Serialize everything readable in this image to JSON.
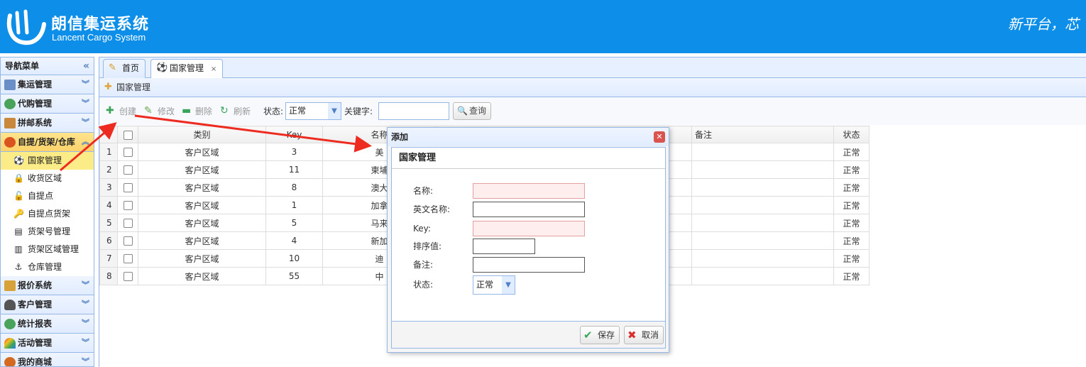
{
  "header": {
    "brand_cn": "朗信集运系统",
    "brand_en": "Lancent Cargo System",
    "slogan": "新平台，芯"
  },
  "sidebar": {
    "title": "导航菜单",
    "collapse_icon": "«",
    "groups": [
      {
        "label": "集运管理",
        "icon": "monitor-icon",
        "color": "#6a8fc7"
      },
      {
        "label": "代购管理",
        "icon": "globe-icon",
        "color": "#4aa35a"
      },
      {
        "label": "拼邮系统",
        "icon": "box-icon",
        "color": "#c9883c"
      },
      {
        "label": "自提/货架/仓库",
        "icon": "stop-icon",
        "color": "#d9541e"
      },
      {
        "label": "报价系统",
        "icon": "coins-icon",
        "color": "#d8a23a"
      },
      {
        "label": "客户管理",
        "icon": "user-icon",
        "color": "#555"
      },
      {
        "label": "统计报表",
        "icon": "globe-icon",
        "color": "#4aa35a"
      },
      {
        "label": "活动管理",
        "icon": "rainbow-icon",
        "color": "#e56b2f"
      },
      {
        "label": "我的商城",
        "icon": "ball-icon",
        "color": "#d46a1f"
      }
    ],
    "sub_items": [
      {
        "label": "国家管理",
        "icon": "⚽"
      },
      {
        "label": "收货区域",
        "icon": "🔒"
      },
      {
        "label": "自提点",
        "icon": "🔓"
      },
      {
        "label": "自提点货架",
        "icon": "🔑"
      },
      {
        "label": "货架号管理",
        "icon": "▤"
      },
      {
        "label": "货架区域管理",
        "icon": "▥"
      },
      {
        "label": "仓库管理",
        "icon": "⚓"
      }
    ]
  },
  "tabs": [
    {
      "label": "首页",
      "icon": "✎"
    },
    {
      "label": "国家管理",
      "icon": "⚽",
      "close": "×"
    }
  ],
  "panel": {
    "title": "国家管理"
  },
  "toolbar": {
    "create": "创建",
    "edit": "修改",
    "delete": "删除",
    "refresh": "刷新",
    "status_label": "状态:",
    "status_value": "正常",
    "keyword_label": "关键字:",
    "keyword_value": "",
    "search": "查询"
  },
  "grid": {
    "columns": [
      "类别",
      "Key",
      "名称",
      "备注",
      "状态"
    ],
    "rows": [
      {
        "num": "1",
        "type": "客户区域",
        "key": "3",
        "name": "美",
        "status": "正常"
      },
      {
        "num": "2",
        "type": "客户区域",
        "key": "11",
        "name": "柬埔",
        "status": "正常"
      },
      {
        "num": "3",
        "type": "客户区域",
        "key": "8",
        "name": "澳大",
        "status": "正常"
      },
      {
        "num": "4",
        "type": "客户区域",
        "key": "1",
        "name": "加拿",
        "status": "正常"
      },
      {
        "num": "5",
        "type": "客户区域",
        "key": "5",
        "name": "马来",
        "status": "正常"
      },
      {
        "num": "6",
        "type": "客户区域",
        "key": "4",
        "name": "新加",
        "status": "正常"
      },
      {
        "num": "7",
        "type": "客户区域",
        "key": "10",
        "name": "迪",
        "status": "正常"
      },
      {
        "num": "8",
        "type": "客户区域",
        "key": "55",
        "name": "中",
        "status": "正常"
      }
    ]
  },
  "dialog": {
    "title": "添加",
    "section": "国家管理",
    "fields": {
      "name": "名称:",
      "en_name": "英文名称:",
      "key": "Key:",
      "sort": "排序值:",
      "remark": "备注:",
      "status": "状态:"
    },
    "status_value": "正常",
    "save": "保存",
    "cancel": "取消"
  },
  "colors": {
    "header_bg": "#0d8fe9",
    "border": "#95b8e7",
    "arrow": "#ee2b20"
  }
}
